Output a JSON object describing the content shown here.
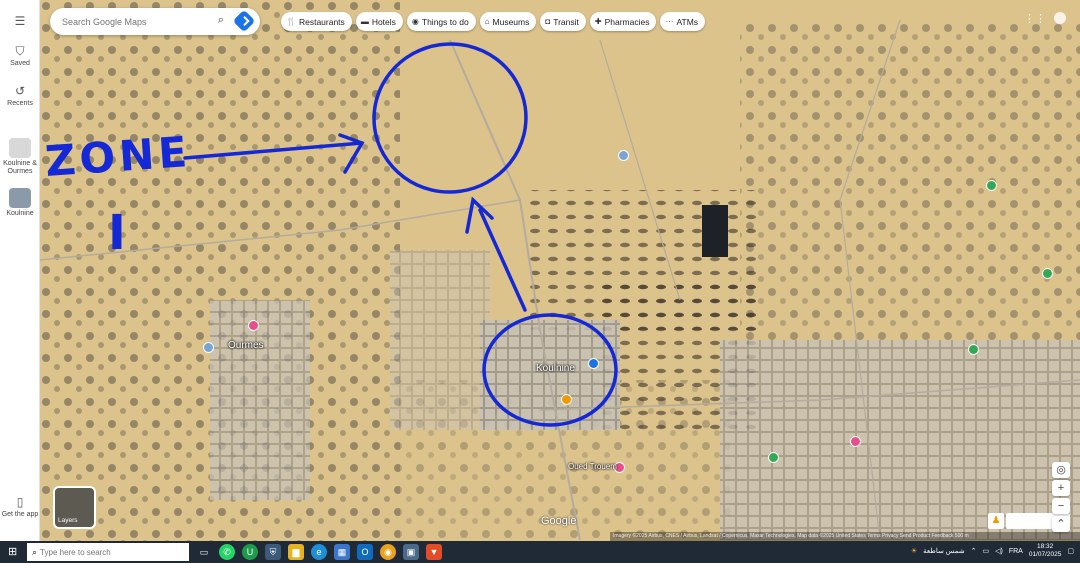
{
  "search": {
    "placeholder": "Search Google Maps"
  },
  "rail": {
    "menu_icon": "menu-icon",
    "saved": "Saved",
    "recents": "Recents",
    "recent_place_1": "Koulnine & Ourmes",
    "recent_place_2": "Koulnine",
    "get_app": "Get the app"
  },
  "chips": [
    {
      "label": "Restaurants",
      "icon": "🍴"
    },
    {
      "label": "Hotels",
      "icon": "▬"
    },
    {
      "label": "Things to do",
      "icon": "◉"
    },
    {
      "label": "Museums",
      "icon": "⌂"
    },
    {
      "label": "Transit",
      "icon": "◘"
    },
    {
      "label": "Pharmacies",
      "icon": "✚"
    },
    {
      "label": "ATMs",
      "icon": "···"
    }
  ],
  "map_labels": {
    "ourmes": "Ourmes",
    "koulnine": "Koulnine",
    "oued_trouem": "Oued Trouem"
  },
  "annotation": {
    "zone_text": "ZONE",
    "zone_number": "I",
    "ink_color": "#1428d6"
  },
  "controls": {
    "layers": "Layers",
    "google": "Google",
    "attribution": "Imagery ©2025 Airbus, CNES / Airbus, Landsat / Copernicus, Maxar Technologies, Map data ©2025   United States   Terms   Privacy   Send Product Feedback   500 m",
    "zoom_in": "+",
    "zoom_out": "−"
  },
  "taskbar": {
    "search_placeholder": "Type here to search",
    "language": "FRA",
    "time": "18:32",
    "date": "01/07/2025",
    "weather": "شمس ساطعة"
  }
}
